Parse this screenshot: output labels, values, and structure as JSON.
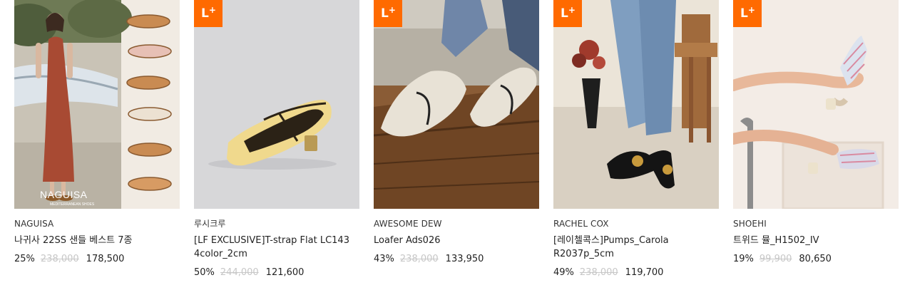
{
  "badge": {
    "label": "L",
    "sup": "+"
  },
  "watermark": {
    "brand": "NAGUISA",
    "tagline": "MEDITERRANEAN SHOES"
  },
  "products": [
    {
      "brand": "NAGUISA",
      "name": "나귀사 22SS 샌들 베스트 7종",
      "discount": "25%",
      "original_price": "238,000",
      "sale_price": "178,500",
      "badge": false
    },
    {
      "brand": "루시크루",
      "name": "[LF EXCLUSIVE]T-strap Flat LC143 4color_2cm",
      "discount": "50%",
      "original_price": "244,000",
      "sale_price": "121,600",
      "badge": true
    },
    {
      "brand": "AWESOME DEW",
      "name": "Loafer Ads026",
      "discount": "43%",
      "original_price": "238,000",
      "sale_price": "133,950",
      "badge": true
    },
    {
      "brand": "RACHEL COX",
      "name": "[레이첼콕스]Pumps_Carola R2037p_5cm",
      "discount": "49%",
      "original_price": "238,000",
      "sale_price": "119,700",
      "badge": true
    },
    {
      "brand": "SHOEHI",
      "name": "트위드 뮬_H1502_IV",
      "discount": "19%",
      "original_price": "99,900",
      "sale_price": "80,650",
      "badge": true
    }
  ]
}
